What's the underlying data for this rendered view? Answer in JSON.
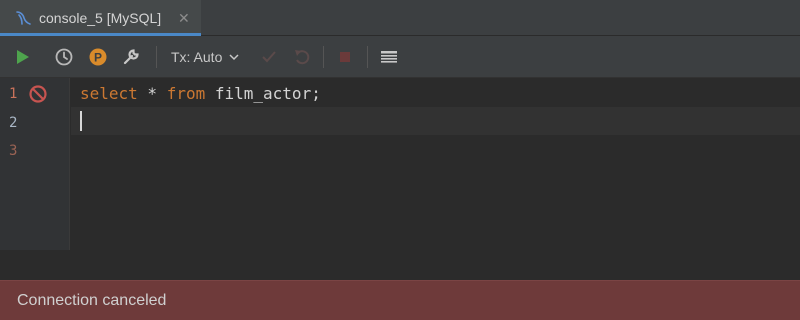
{
  "tab": {
    "icon": "mysql-dolphin-icon",
    "label": "console_5 [MySQL]",
    "close": "✕"
  },
  "toolbar": {
    "run_icon": "play-icon",
    "history_icon": "clock-icon",
    "profile_icon": "p-icon",
    "settings_icon": "wrench-icon",
    "tx_label": "Tx: Auto",
    "commit_icon": "check-icon",
    "rollback_icon": "undo-icon",
    "stop_icon": "stop-icon",
    "table_icon": "table-icon"
  },
  "editor": {
    "line_numbers": [
      "1",
      "2",
      "3"
    ],
    "code": {
      "kw_select": "select",
      "star": " * ",
      "kw_from": "from",
      "rest": " film_actor;"
    }
  },
  "status": {
    "message": "Connection canceled"
  },
  "colors": {
    "keyword": "#cc7832",
    "run": "#4ea44d",
    "profile": "#d98b2b",
    "status_bg": "#6e3a3a",
    "cancel_marker": "#c75450"
  }
}
